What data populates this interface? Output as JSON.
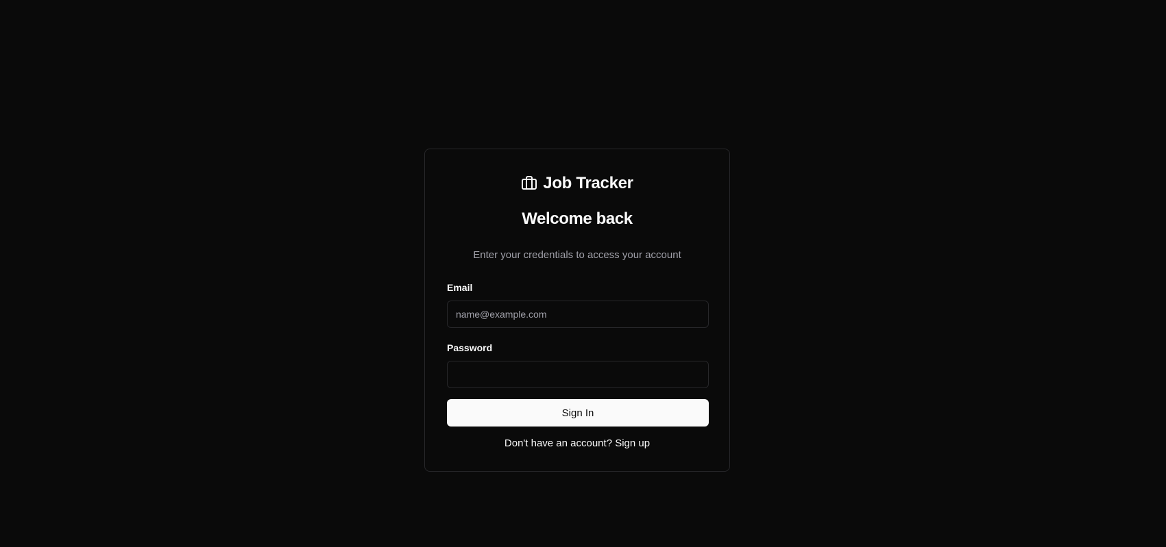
{
  "brand": {
    "icon": "briefcase-icon",
    "name": "Job Tracker"
  },
  "heading": "Welcome back",
  "subheading": "Enter your credentials to access your account",
  "form": {
    "email_label": "Email",
    "email_placeholder": "name@example.com",
    "email_value": "",
    "password_label": "Password",
    "password_value": "",
    "submit_label": "Sign In"
  },
  "footer": {
    "prompt": "Don't have an account?",
    "link_label": "Sign up"
  },
  "colors": {
    "background": "#0a0a0a",
    "border": "#27272a",
    "text": "#fafafa",
    "muted_text": "#a1a1aa",
    "button_bg": "#fafafa",
    "button_text": "#0a0a0a"
  }
}
